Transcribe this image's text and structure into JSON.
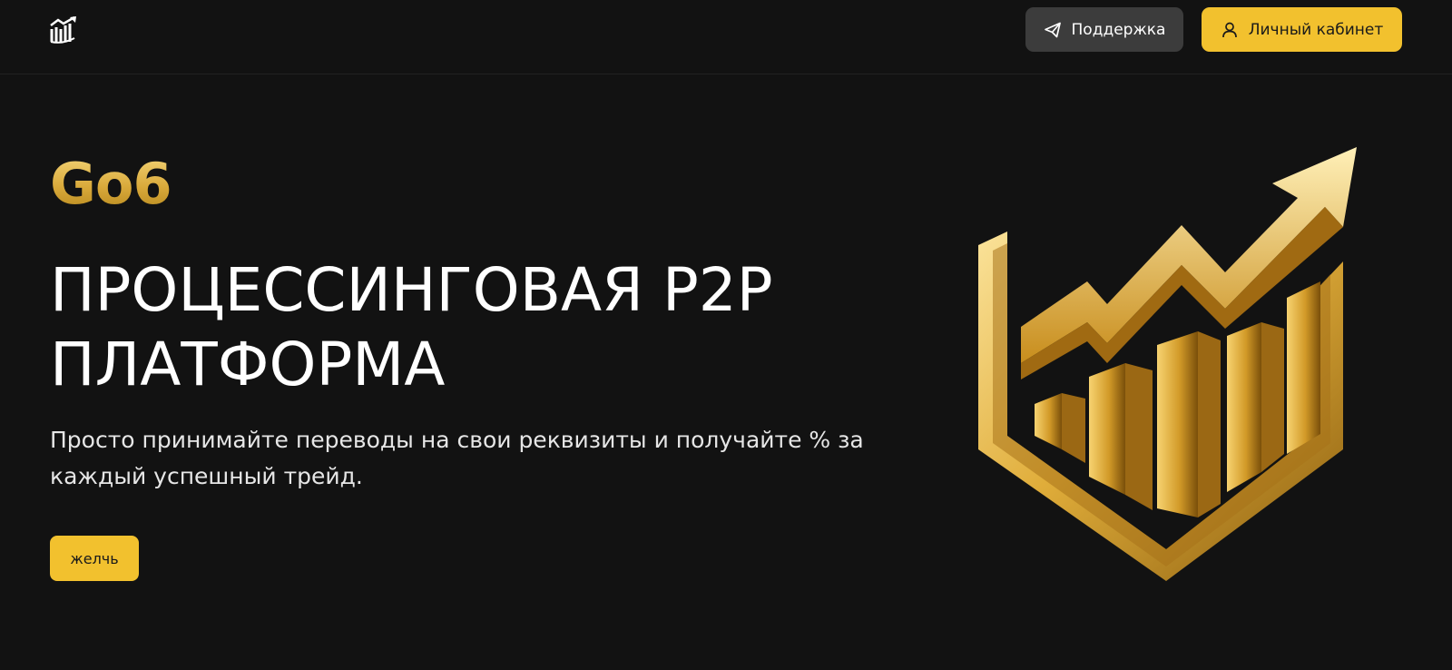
{
  "header": {
    "logo_icon": "chart-growth-logo-icon",
    "support_button": {
      "label": "Поддержка",
      "icon": "telegram-send-icon"
    },
    "cabinet_button": {
      "label": "Личный кабинет",
      "icon": "user-icon"
    }
  },
  "hero": {
    "brand": "Go6",
    "title": "ПРОЦЕССИНГОВАЯ P2P\nПЛАТФОРМА",
    "subtitle": "Просто принимайте переводы на свои реквизиты и получайте % за каждый успешный трейд.",
    "cta_label": "желчь",
    "illustration_icon": "gold-shield-growth-chart-icon"
  },
  "colors": {
    "background": "#121212",
    "accent_gold": "#f2c12e",
    "support_button_bg": "#3c3c3c"
  }
}
